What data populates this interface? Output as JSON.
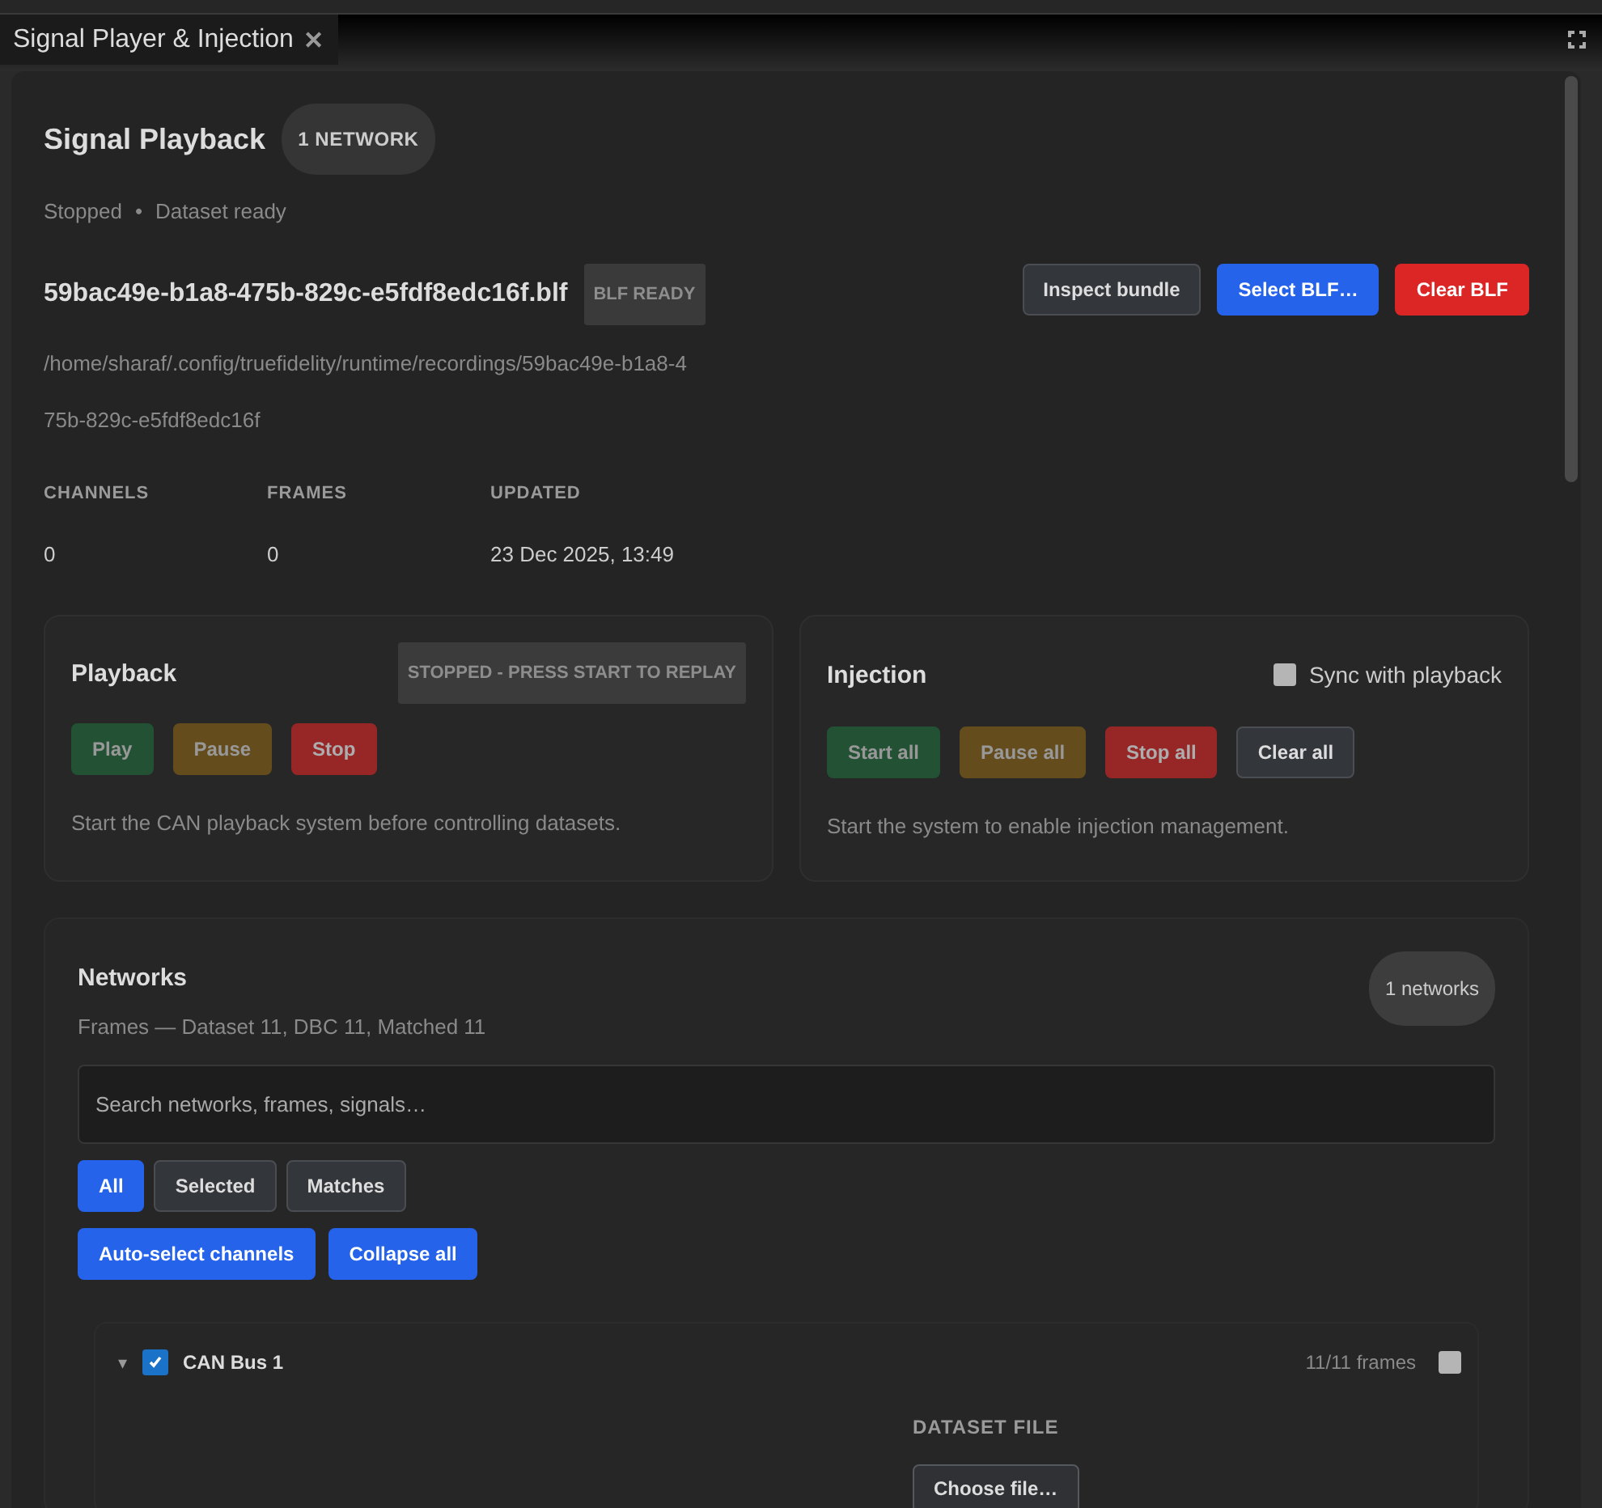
{
  "tab": {
    "title": "Signal Player & Injection",
    "close": "✕"
  },
  "header": {
    "title": "Signal Playback",
    "badge": "1 NETWORK",
    "status": [
      "Stopped",
      "Dataset ready"
    ],
    "separator": "•"
  },
  "file": {
    "name": "59bac49e-b1a8-475b-829c-e5fdf8edc16f.blf",
    "badge": "BLF READY",
    "path": "/home/sharaf/.config/truefidelity/runtime/recordings/59bac49e-b1a8-475b-829c-e5fdf8edc16f",
    "actions": [
      {
        "label": "Inspect bundle",
        "kind": "neutral"
      },
      {
        "label": "Select BLF…",
        "kind": "primary"
      },
      {
        "label": "Clear BLF",
        "kind": "danger"
      }
    ]
  },
  "stats": [
    {
      "label": "CHANNELS",
      "value": "0"
    },
    {
      "label": "FRAMES",
      "value": "0"
    },
    {
      "label": "UPDATED",
      "value": "23 Dec 2025, 13:49"
    }
  ],
  "playback": {
    "title": "Playback",
    "status": "STOPPED - PRESS START TO REPLAY",
    "buttons": [
      {
        "label": "Play",
        "kind": "success",
        "disabled": true
      },
      {
        "label": "Pause",
        "kind": "warning",
        "disabled": true
      },
      {
        "label": "Stop",
        "kind": "danger",
        "disabled": true
      }
    ],
    "hint": "Start the CAN playback system before controlling datasets."
  },
  "injection": {
    "title": "Injection",
    "sync": {
      "label": "Sync with playback",
      "checked": false
    },
    "buttons": [
      {
        "label": "Start all",
        "kind": "success",
        "disabled": true
      },
      {
        "label": "Pause all",
        "kind": "warning",
        "disabled": true
      },
      {
        "label": "Stop all",
        "kind": "danger",
        "disabled": true
      },
      {
        "label": "Clear all",
        "kind": "neutral",
        "disabled": false
      }
    ],
    "hint": "Start the system to enable injection management."
  },
  "networks": {
    "title": "Networks",
    "summary": "Frames — Dataset 11, DBC 11, Matched 11",
    "count": "1 networks",
    "search": {
      "placeholder": "Search networks, frames, signals…"
    },
    "filters": [
      {
        "label": "All",
        "selected": true
      },
      {
        "label": "Selected",
        "selected": false
      },
      {
        "label": "Matches",
        "selected": false
      }
    ],
    "actions": [
      {
        "label": "Auto-select channels",
        "kind": "primary"
      },
      {
        "label": "Collapse all",
        "kind": "primary"
      }
    ],
    "items": [
      {
        "name": "CAN Bus 1",
        "caret": "▾",
        "expanded": true,
        "checked": true,
        "frames": "11/11 frames",
        "selected": false,
        "field_label": "DATASET FILE",
        "button": "Choose file…"
      }
    ]
  }
}
